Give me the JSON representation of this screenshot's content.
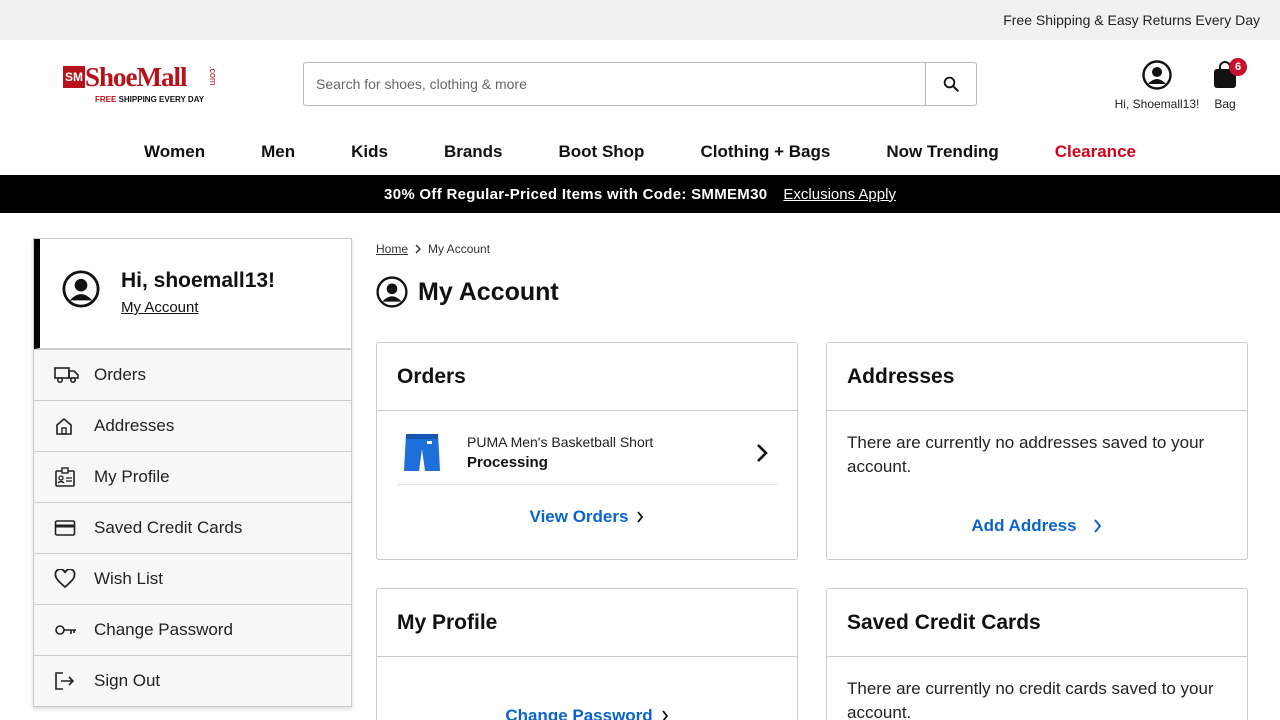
{
  "topbar": {
    "message": "Free Shipping & Easy Returns Every Day"
  },
  "logo": {
    "mark": "SM",
    "word": "ShoeMall",
    "com": ".com",
    "tag_red": "FREE",
    "tag_rest": " SHIPPING EVERY DAY"
  },
  "search": {
    "placeholder": "Search for shoes, clothing & more",
    "value": ""
  },
  "account": {
    "label": "Hi, Shoemall13!"
  },
  "bag": {
    "label": "Bag",
    "count": "6"
  },
  "nav": {
    "items": [
      "Women",
      "Men",
      "Kids",
      "Brands",
      "Boot Shop",
      "Clothing + Bags",
      "Now Trending",
      "Clearance"
    ]
  },
  "promo": {
    "text": "30% Off Regular-Priced Items with Code: SMMEM30",
    "link": "Exclusions Apply"
  },
  "sidebar": {
    "greeting": "Hi, shoemall13!",
    "account_link": "My Account",
    "items": [
      {
        "label": "Orders",
        "icon": "truck-icon"
      },
      {
        "label": "Addresses",
        "icon": "home-icon"
      },
      {
        "label": "My Profile",
        "icon": "id-card-icon"
      },
      {
        "label": "Saved Credit Cards",
        "icon": "credit-card-icon"
      },
      {
        "label": "Wish List",
        "icon": "heart-icon"
      },
      {
        "label": "Change Password",
        "icon": "key-icon"
      },
      {
        "label": "Sign Out",
        "icon": "sign-out-icon"
      }
    ]
  },
  "breadcrumb": {
    "home": "Home",
    "current": "My Account"
  },
  "page": {
    "title": "My Account"
  },
  "cards": {
    "orders": {
      "title": "Orders",
      "item_name": "PUMA Men's Basketball Short",
      "item_status": "Processing",
      "link": "View Orders"
    },
    "addresses": {
      "title": "Addresses",
      "empty": "There are currently no addresses saved to your account.",
      "link": "Add Address"
    },
    "profile": {
      "title": "My Profile",
      "link": "Change Password"
    },
    "cards": {
      "title": "Saved Credit Cards",
      "empty": "There are currently no credit cards saved to your account."
    }
  },
  "colors": {
    "brand_red": "#b5121b",
    "link_blue": "#0b63ce",
    "clearance_red": "#d0021b",
    "badge_red": "#c8102e"
  }
}
